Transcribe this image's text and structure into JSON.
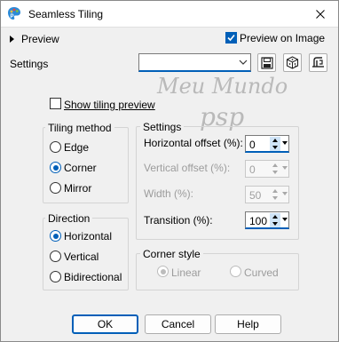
{
  "window": {
    "title": "Seamless Tiling",
    "icon": "psp-palette-icon"
  },
  "preview": {
    "label": "Preview",
    "preview_on_image_label": "Preview on Image",
    "preview_on_image_checked": true
  },
  "settings": {
    "label": "Settings",
    "preset_value": "",
    "buttons": [
      "save-preset-icon",
      "randomize-dice-icon",
      "reset-icon"
    ]
  },
  "show_tiling_preview": {
    "label": "Show tiling preview",
    "checked": false
  },
  "watermark": {
    "line1": "Meu Mundo",
    "line2": "psp"
  },
  "tiling_method": {
    "title": "Tiling method",
    "options": [
      {
        "label": "Edge",
        "checked": false
      },
      {
        "label": "Corner",
        "checked": true
      },
      {
        "label": "Mirror",
        "checked": false
      }
    ]
  },
  "direction": {
    "title": "Direction",
    "options": [
      {
        "label": "Horizontal",
        "checked": true
      },
      {
        "label": "Vertical",
        "checked": false
      },
      {
        "label": "Bidirectional",
        "checked": false
      }
    ]
  },
  "settings_group": {
    "title": "Settings",
    "fields": [
      {
        "label": "Horizontal offset (%):",
        "value": "0",
        "enabled": true
      },
      {
        "label": "Vertical offset (%):",
        "value": "0",
        "enabled": false
      },
      {
        "label": "Width (%):",
        "value": "50",
        "enabled": false
      },
      {
        "label": "Transition (%):",
        "value": "100",
        "enabled": true
      }
    ]
  },
  "corner_style": {
    "title": "Corner style",
    "options": [
      {
        "label": "Linear",
        "checked": true,
        "enabled": false
      },
      {
        "label": "Curved",
        "checked": false,
        "enabled": false
      }
    ]
  },
  "buttons": {
    "ok": "OK",
    "cancel": "Cancel",
    "help": "Help"
  },
  "colors": {
    "accent": "#005fb8",
    "background": "#f0f0f0",
    "disabled_text": "#9c9c9c"
  }
}
